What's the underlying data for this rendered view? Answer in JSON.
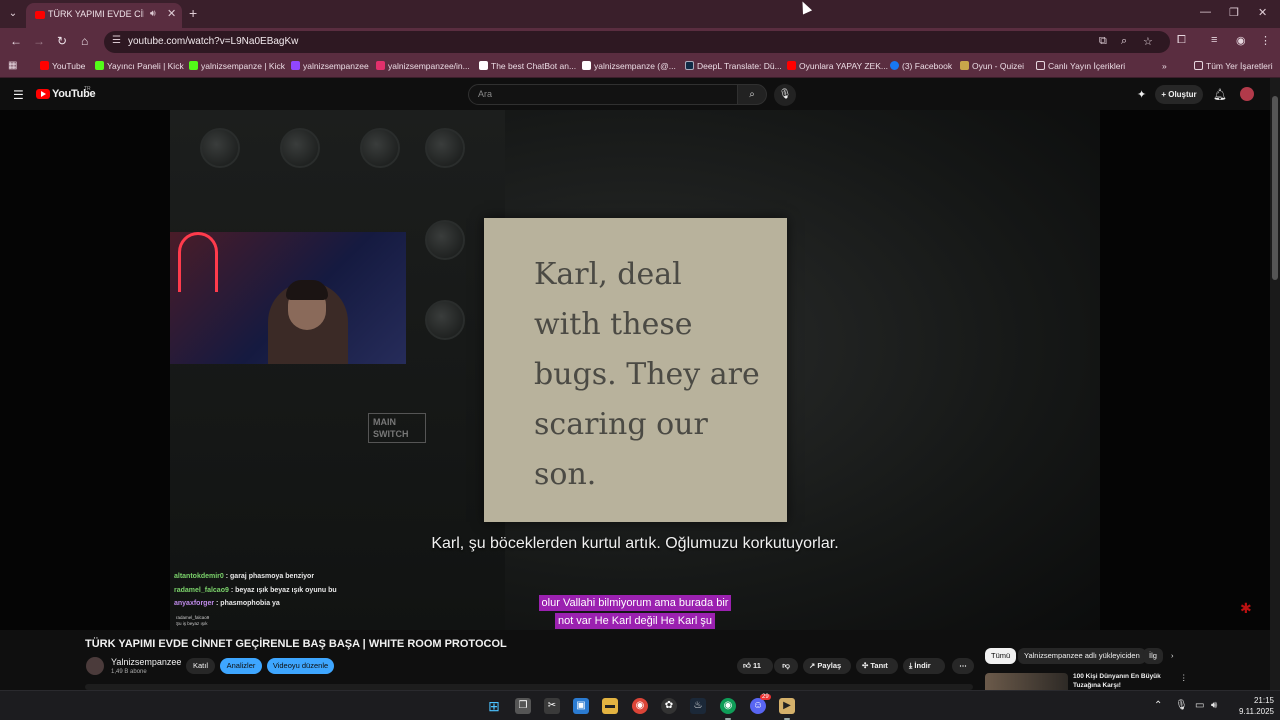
{
  "browser": {
    "tab_title": "TÜRK YAPIMI EVDE CİNNET",
    "url": "youtube.com/watch?v=L9Na0EBagKw",
    "colors": {
      "chrome": "#5a2d40",
      "tab_strip": "#3a1f2b"
    },
    "bookmarks": [
      {
        "label": "YouTube",
        "icon": "youtube-icon",
        "color": "#ff0000"
      },
      {
        "label": "Yayıncı Paneli | Kick",
        "icon": "kick-icon",
        "color": "#53fc18"
      },
      {
        "label": "yalnizsempanze | Kick",
        "icon": "kick-icon",
        "color": "#53fc18"
      },
      {
        "label": "yalnizsempanzee",
        "icon": "twitch-icon",
        "color": "#9146ff"
      },
      {
        "label": "yalnizsempanzee/in...",
        "icon": "instagram-icon",
        "color": "#e1306c"
      },
      {
        "label": "The best ChatBot an...",
        "icon": "chatbot-icon",
        "color": "#ffffff"
      },
      {
        "label": "yalnizsempanze (@...",
        "icon": "tiktok-icon",
        "color": "#ffffff"
      },
      {
        "label": "DeepL Translate: Dü...",
        "icon": "deepl-icon",
        "color": "#0f2b46"
      },
      {
        "label": "Oyunlara YAPAY ZEK...",
        "icon": "youtube-icon",
        "color": "#ff0000"
      },
      {
        "label": "(3) Facebook",
        "icon": "facebook-icon",
        "color": "#1877f2"
      },
      {
        "label": "Oyun - Quizei",
        "icon": "quiz-icon",
        "color": "#c8a64a"
      },
      {
        "label": "Canlı Yayın İçerikleri",
        "icon": "folder-icon",
        "color": "#e6d6de"
      }
    ],
    "all_bookmarks_label": "Tüm Yer İşaretleri"
  },
  "youtube": {
    "wordmark": "YouTube",
    "region": "TR",
    "search_placeholder": "Ara",
    "create_label": "Oluştur"
  },
  "video": {
    "note_text": "Karl, deal\nwith these\nbugs. They are\nscaring our\nson.",
    "switch_label": "MAIN\nSWITCH",
    "subtitle": "Karl, şu böceklerden kurtul artık. Oğlumuzu korkutuyorlar.",
    "caption_lines": [
      "olur Vallahi bilmiyorum ama burada bir",
      "not var He Karl değil He Karl şu"
    ],
    "chat": [
      {
        "user": "altantokdemir0",
        "text": ": garaj phasmoya benziyor"
      },
      {
        "user": "radamel_falcao9",
        "text": ": beyaz ışık beyaz ışık oyunu bu"
      },
      {
        "user": "anyaxforger",
        "text": ": phasmophobia ya"
      }
    ],
    "mini_chat": [
      "radamel_falcao9",
      "Şu iş beyaz ışık"
    ],
    "title": "TÜRK YAPIMI EVDE CİNNET GEÇİRENLE BAŞ BAŞA | WHITE ROOM PROTOCOL"
  },
  "channel": {
    "name": "Yalnizsempanzee",
    "subs": "1,49 B abone",
    "join_label": "Katıl",
    "analytics_label": "Analizler",
    "edit_label": "Videoyu düzenle"
  },
  "actions": {
    "likes": "11",
    "share": "Paylaş",
    "promote": "Tanıt",
    "download": "İndir"
  },
  "related": {
    "chips": [
      "Tümü",
      "Yalnizsempanzee adlı yükleyiciden",
      "İlg"
    ],
    "first_title": "100 Kişi Dünyanın En Büyük Tuzağına Karşı!"
  },
  "taskbar": {
    "time": "21:15",
    "date": "9.11.2025",
    "discord_badge": "29"
  }
}
